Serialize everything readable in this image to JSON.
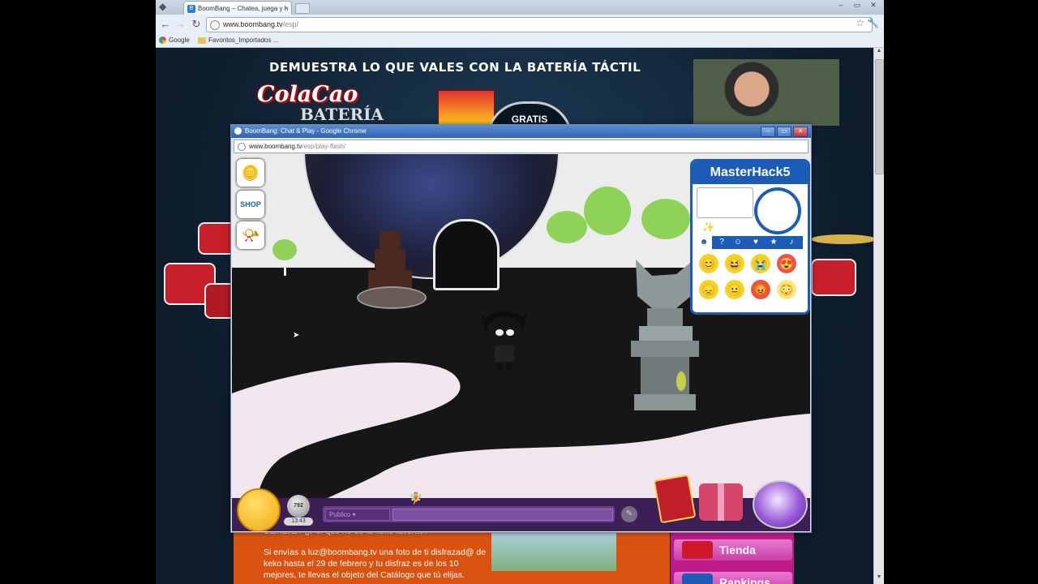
{
  "browser": {
    "tab_title": "BoomBang – Chatea, juega y h",
    "tab_close": "×",
    "url_host": "www.boombang.tv",
    "url_path": "/esp/",
    "bookmarks": [
      "Google",
      "Favoritos_Importados ..."
    ]
  },
  "banner": {
    "headline": "DEMUESTRA LO QUE VALES CON LA BATERÍA TÁCTIL",
    "brand": "ColaCao",
    "product": "BATERÍA",
    "gratis": "GRATIS"
  },
  "popup": {
    "title": "BoomBang: Chat & Play - Google Chrome",
    "url_host": "www.boombang.tv",
    "url_path": "/esp/play-flash/"
  },
  "game": {
    "hud": {
      "coins_icon": "coins-icon",
      "shop_label": "SHOP",
      "shop_icon": "shop-icon",
      "whistle_icon": "whistle-icon"
    },
    "profile": {
      "username": "MasterHack5",
      "emoticons": [
        "😊",
        "😆",
        "😭",
        "😍",
        "😞",
        "😐",
        "😡",
        "😳"
      ]
    },
    "bottom": {
      "clock_value": "792",
      "clock_time": "13:43",
      "chat_channel": "Publico"
    }
  },
  "page": {
    "article_text": "Carnaval? ¿Por qué no de tu keko favorito?",
    "article_text2": "Si envías a luz@boombang.tv una foto de ti disfrazad@ de keko hasta el 29 de febrero y tu disfraz es de los 10 mejores, te llevas el objeto del Catálogo que tú elijas.",
    "menu": [
      "Tienda",
      "Rankings"
    ]
  },
  "colors": {
    "accent_blue": "#1d5bb8",
    "menu_pink": "#c01a8a",
    "orange": "#d9520f"
  }
}
